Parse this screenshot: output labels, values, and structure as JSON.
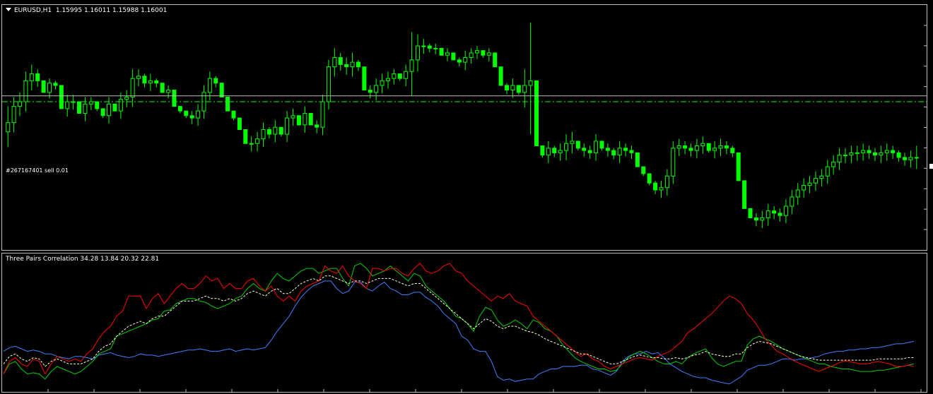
{
  "main": {
    "symbol": "EURUSD,H1",
    "ohlc": "1.15995 1.16011 1.15988 1.16001",
    "order_label": "#267167401 sell 0.01",
    "colors": {
      "candle": "#00ff00",
      "order_line": "#c0c0c0",
      "sl_line": "#00ff00"
    }
  },
  "indicator": {
    "title": "Three Pairs Correlation 34.28 13.84 20.32 22.81",
    "colors": {
      "blue": "#3f7fff",
      "green": "#00d000",
      "red": "#ff0000",
      "avg": "#ffffcc"
    }
  },
  "chart_data": [
    {
      "type": "candlestick",
      "title": "EURUSD,H1",
      "ylim": [
        0,
        100
      ],
      "order_line": 64.5,
      "stop_line": 62,
      "closes": [
        53,
        60,
        62,
        71,
        74,
        71,
        66,
        70,
        69,
        59,
        62,
        62,
        57,
        61,
        62,
        59,
        56,
        61,
        58,
        63,
        64,
        72,
        73,
        70,
        71,
        70,
        66,
        67,
        60,
        58,
        56,
        55,
        58,
        66,
        72,
        70,
        64,
        58,
        55,
        50,
        44,
        44,
        46,
        50,
        48,
        51,
        48,
        55,
        56,
        52,
        57,
        52,
        51,
        62,
        77,
        81,
        78,
        77,
        79,
        77,
        67,
        66,
        69,
        71,
        72,
        74,
        72,
        75,
        80,
        86,
        86,
        85,
        85,
        82,
        83,
        80,
        79,
        81,
        83,
        84,
        82,
        83,
        77,
        69,
        67,
        69,
        66,
        69,
        71,
        43,
        39,
        42,
        40,
        41,
        44,
        45,
        42,
        41,
        40,
        45,
        42,
        41,
        39,
        42,
        41,
        40,
        34,
        31,
        27,
        24,
        25,
        30,
        42,
        43,
        42,
        41,
        43,
        44,
        41,
        42,
        43,
        42,
        40,
        28,
        16,
        12,
        11,
        12,
        15,
        14,
        13,
        17,
        21,
        24,
        26,
        27,
        29,
        30,
        34,
        36,
        39,
        39,
        40,
        40,
        41,
        40,
        39,
        40,
        41,
        40,
        38,
        37,
        38,
        38
      ],
      "highs": [
        60,
        64,
        66,
        75,
        78,
        76,
        70,
        72,
        71,
        62,
        65,
        65,
        60,
        64,
        64,
        62,
        59,
        64,
        60,
        66,
        67,
        76,
        76,
        74,
        74,
        72,
        69,
        69,
        63,
        60,
        58,
        58,
        61,
        69,
        75,
        73,
        66,
        61,
        58,
        53,
        48,
        47,
        49,
        53,
        51,
        54,
        51,
        58,
        59,
        55,
        60,
        55,
        54,
        65,
        80,
        85,
        83,
        81,
        83,
        80,
        70,
        69,
        72,
        74,
        75,
        76,
        74,
        78,
        92,
        91,
        89,
        87,
        87,
        84,
        85,
        82,
        81,
        84,
        85,
        86,
        84,
        85,
        80,
        72,
        70,
        72,
        69,
        76,
        96,
        47,
        43,
        45,
        43,
        44,
        48,
        49,
        45,
        44,
        43,
        48,
        45,
        44,
        42,
        45,
        44,
        43,
        37,
        34,
        31,
        28,
        28,
        33,
        45,
        46,
        45,
        44,
        46,
        47,
        44,
        45,
        46,
        45,
        43,
        31,
        20,
        15,
        14,
        15,
        18,
        17,
        16,
        20,
        24,
        27,
        29,
        30,
        32,
        33,
        37,
        39,
        42,
        42,
        43,
        43,
        44,
        43,
        42,
        43,
        44,
        43,
        41,
        40,
        41,
        43
      ]
    },
    {
      "type": "line",
      "title": "Three Pairs Correlation",
      "ylim": [
        0,
        100
      ],
      "series": [
        {
          "values": [
            30,
            33,
            34,
            32,
            30,
            31,
            30,
            28,
            28,
            26,
            25,
            24,
            26,
            26,
            25,
            24,
            27,
            28,
            29,
            27,
            26,
            25,
            26,
            28,
            27,
            27,
            26,
            27,
            28,
            29,
            30,
            31,
            31,
            32,
            31,
            30,
            30,
            31,
            32,
            30,
            31,
            32,
            31,
            32,
            33,
            39,
            46,
            52,
            58,
            66,
            73,
            78,
            82,
            84,
            86,
            86,
            80,
            76,
            78,
            85,
            85,
            80,
            78,
            82,
            85,
            80,
            78,
            75,
            75,
            77,
            77,
            73,
            70,
            66,
            60,
            56,
            52,
            42,
            39,
            32,
            30,
            30,
            22,
            10,
            7,
            8,
            6,
            7,
            8,
            8,
            12,
            14,
            16,
            16,
            18,
            18,
            18,
            19,
            19,
            16,
            15,
            13,
            11,
            14,
            22,
            26,
            28,
            28,
            30,
            28,
            29,
            25,
            20,
            17,
            14,
            12,
            10,
            9,
            9,
            7,
            6,
            5,
            4,
            7,
            10,
            15,
            17,
            19,
            19,
            20,
            22,
            24,
            24,
            23,
            24,
            24,
            25,
            26,
            28,
            29,
            30,
            30,
            31,
            31,
            32,
            32,
            33,
            33,
            34,
            35,
            36,
            36,
            37,
            38
          ]
        },
        {
          "values": [
            12,
            20,
            22,
            16,
            12,
            13,
            12,
            8,
            14,
            18,
            16,
            14,
            12,
            14,
            18,
            22,
            28,
            30,
            32,
            42,
            44,
            46,
            48,
            50,
            52,
            55,
            56,
            62,
            63,
            68,
            70,
            72,
            72,
            70,
            69,
            66,
            64,
            66,
            68,
            72,
            74,
            80,
            84,
            80,
            78,
            86,
            92,
            88,
            86,
            90,
            94,
            96,
            96,
            92,
            94,
            96,
            96,
            88,
            82,
            98,
            100,
            96,
            90,
            92,
            94,
            98,
            94,
            90,
            86,
            92,
            90,
            82,
            78,
            74,
            70,
            64,
            58,
            56,
            52,
            46,
            58,
            65,
            63,
            55,
            50,
            52,
            55,
            52,
            48,
            55,
            53,
            48,
            46,
            42,
            35,
            30,
            25,
            22,
            20,
            18,
            16,
            16,
            14,
            15,
            20,
            25,
            28,
            30,
            28,
            25,
            22,
            20,
            20,
            22,
            20,
            25,
            28,
            30,
            32,
            25,
            20,
            18,
            20,
            22,
            22,
            35,
            40,
            42,
            40,
            38,
            35,
            32,
            30,
            28,
            26,
            24,
            22,
            20,
            20,
            18,
            17,
            16,
            16,
            15,
            14,
            14,
            14,
            15,
            15,
            16,
            17,
            18,
            19,
            20
          ]
        },
        {
          "values": [
            12,
            22,
            25,
            20,
            18,
            24,
            22,
            12,
            20,
            26,
            24,
            22,
            24,
            22,
            28,
            32,
            40,
            46,
            50,
            58,
            62,
            74,
            74,
            74,
            64,
            72,
            76,
            68,
            74,
            80,
            84,
            80,
            80,
            84,
            90,
            86,
            88,
            80,
            84,
            80,
            80,
            86,
            88,
            82,
            78,
            82,
            74,
            70,
            74,
            70,
            78,
            82,
            84,
            86,
            98,
            94,
            92,
            98,
            90,
            86,
            84,
            80,
            96,
            96,
            94,
            96,
            96,
            92,
            90,
            96,
            100,
            94,
            92,
            94,
            98,
            100,
            94,
            92,
            86,
            82,
            78,
            74,
            70,
            74,
            72,
            76,
            70,
            68,
            66,
            58,
            54,
            50,
            46,
            42,
            38,
            34,
            30,
            26,
            28,
            24,
            22,
            18,
            16,
            18,
            20,
            22,
            24,
            25,
            24,
            23,
            26,
            28,
            30,
            34,
            38,
            45,
            48,
            52,
            56,
            60,
            65,
            70,
            74,
            72,
            68,
            60,
            55,
            48,
            40,
            35,
            30,
            28,
            25,
            22,
            20,
            18,
            16,
            14,
            16,
            18,
            20,
            22,
            22,
            21,
            20,
            20,
            21,
            22,
            21,
            20,
            18,
            18,
            19,
            18
          ]
        },
        {
          "values": [
            20,
            26,
            28,
            24,
            22,
            25,
            24,
            18,
            22,
            24,
            22,
            20,
            20,
            20,
            22,
            24,
            30,
            34,
            36,
            42,
            46,
            50,
            52,
            54,
            52,
            56,
            58,
            58,
            62,
            66,
            70,
            70,
            70,
            72,
            74,
            72,
            72,
            70,
            72,
            70,
            72,
            76,
            78,
            76,
            74,
            78,
            80,
            76,
            76,
            80,
            84,
            86,
            88,
            86,
            90,
            90,
            88,
            86,
            84,
            86,
            86,
            84,
            86,
            88,
            88,
            88,
            86,
            84,
            82,
            84,
            84,
            80,
            76,
            72,
            68,
            64,
            60,
            56,
            52,
            48,
            52,
            56,
            54,
            50,
            48,
            50,
            50,
            48,
            46,
            45,
            43,
            40,
            38,
            36,
            34,
            32,
            30,
            28,
            28,
            26,
            24,
            22,
            20,
            20,
            22,
            24,
            26,
            27,
            26,
            25,
            25,
            24,
            24,
            25,
            24,
            25,
            27,
            28,
            30,
            28,
            27,
            26,
            26,
            28,
            28,
            33,
            36,
            38,
            37,
            36,
            34,
            32,
            30,
            28,
            26,
            25,
            24,
            23,
            23,
            23,
            23,
            23,
            23,
            23,
            23,
            23,
            23,
            24,
            24,
            24,
            24,
            24,
            25,
            25
          ]
        }
      ]
    }
  ]
}
